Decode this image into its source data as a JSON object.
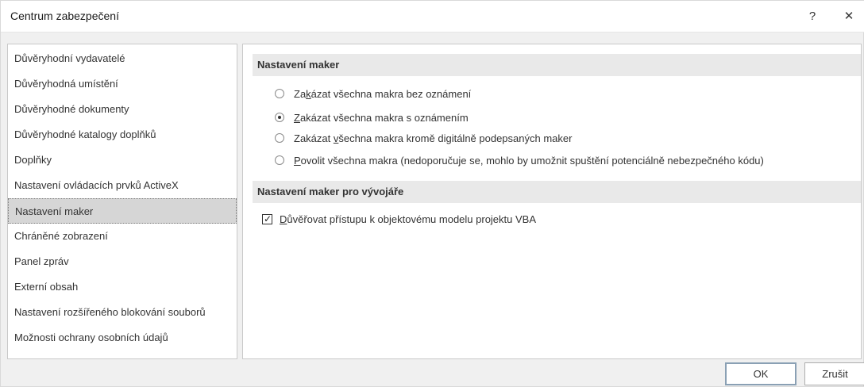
{
  "window": {
    "title": "Centrum zabezpečení",
    "help_glyph": "?",
    "close_glyph": "✕"
  },
  "sidebar": {
    "items": [
      {
        "label": "Důvěryhodní vydavatelé",
        "selected": false
      },
      {
        "label": "Důvěryhodná umístění",
        "selected": false
      },
      {
        "label": "Důvěryhodné dokumenty",
        "selected": false
      },
      {
        "label": "Důvěryhodné katalogy doplňků",
        "selected": false
      },
      {
        "label": "Doplňky",
        "selected": false
      },
      {
        "label": "Nastavení ovládacích prvků ActiveX",
        "selected": false
      },
      {
        "label": "Nastavení maker",
        "selected": true
      },
      {
        "label": "Chráněné zobrazení",
        "selected": false
      },
      {
        "label": "Panel zpráv",
        "selected": false
      },
      {
        "label": "Externí obsah",
        "selected": false
      },
      {
        "label": "Nastavení rozšířeného blokování souborů",
        "selected": false
      },
      {
        "label": "Možnosti ochrany osobních údajů",
        "selected": false
      }
    ]
  },
  "macro_settings": {
    "header": "Nastavení maker",
    "options": [
      {
        "pre": "Za",
        "key": "k",
        "post": "ázat všechna makra bez oznámení",
        "checked": false
      },
      {
        "pre": "",
        "key": "Z",
        "post": "akázat všechna makra s oznámením",
        "checked": true
      },
      {
        "pre": "Zakázat ",
        "key": "v",
        "post": "šechna makra kromě digitálně podepsaných maker",
        "checked": false
      },
      {
        "pre": "",
        "key": "P",
        "post": "ovolit všechna makra (nedoporučuje se, mohlo by umožnit spuštění potenciálně nebezpečného kódu)",
        "checked": false
      }
    ]
  },
  "developer_settings": {
    "header": "Nastavení maker pro vývojáře",
    "checkbox": {
      "key": "D",
      "post": "ůvěřovat přístupu k objektovému modelu projektu VBA",
      "checked": true
    }
  },
  "buttons": {
    "ok": "OK",
    "cancel": "Zrušit"
  }
}
